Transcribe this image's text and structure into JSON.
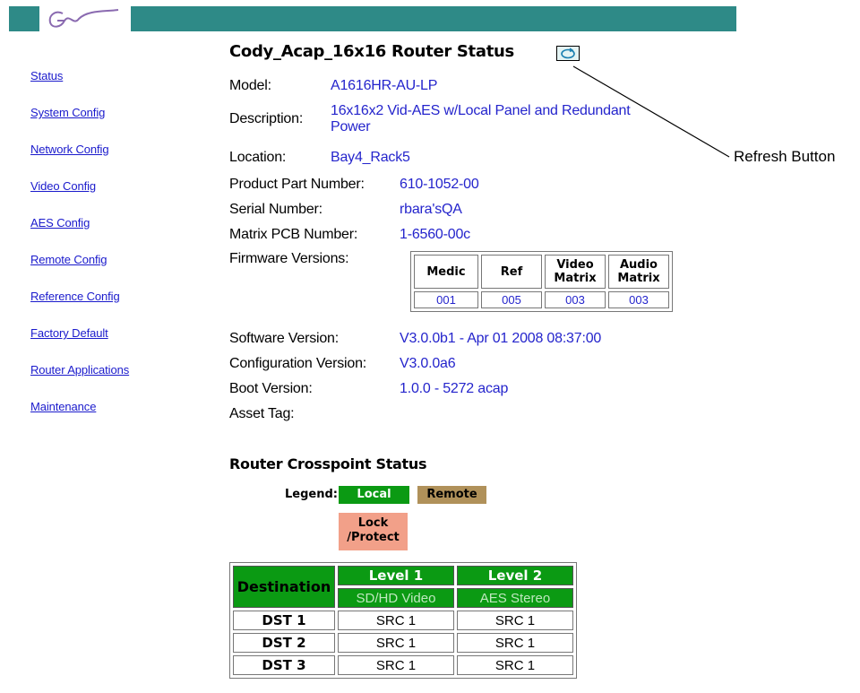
{
  "header": {
    "brand_color": "#2e8a87",
    "logo_icon": "grass-valley-logo"
  },
  "nav": {
    "items": [
      {
        "label": "Status"
      },
      {
        "label": "System Config"
      },
      {
        "label": "Network Config"
      },
      {
        "label": "Video Config"
      },
      {
        "label": "AES Config"
      },
      {
        "label": "Remote Config"
      },
      {
        "label": "Reference Config"
      },
      {
        "label": "Factory Default"
      },
      {
        "label": "Router Applications"
      },
      {
        "label": "Maintenance"
      }
    ]
  },
  "page": {
    "title": "Cody_Acap_16x16 Router Status",
    "refresh_icon": "refresh-icon",
    "annotation": "Refresh Button"
  },
  "info": {
    "model_label": "Model:",
    "model_value": "A1616HR-AU-LP",
    "description_label": "Description:",
    "description_value_line1": "16x16x2 Vid-AES w/Local Panel and Redundant",
    "description_value_line2": "Power",
    "location_label": "Location:",
    "location_value": "Bay4_Rack5",
    "part_label": "Product Part Number:",
    "part_value": "610-1052-00",
    "serial_label": "Serial Number:",
    "serial_value": "rbara'sQA",
    "pcb_label": "Matrix PCB Number:",
    "pcb_value": "1-6560-00c",
    "firmware_label": "Firmware Versions:",
    "software_label": "Software Version:",
    "software_value": "V3.0.0b1 - Apr 01 2008 08:37:00",
    "config_label": "Configuration Version:",
    "config_value": "V3.0.0a6",
    "boot_label": "Boot Version:",
    "boot_value": "1.0.0 - 5272 acap",
    "asset_label": "Asset Tag:"
  },
  "firmware": {
    "headers": [
      "Medic",
      "Ref",
      "Video\nMatrix",
      "Audio\nMatrix"
    ],
    "header_lines": [
      [
        "Medic"
      ],
      [
        "Ref"
      ],
      [
        "Video",
        "Matrix"
      ],
      [
        "Audio",
        "Matrix"
      ]
    ],
    "values": [
      "001",
      "005",
      "003",
      "003"
    ]
  },
  "crosspoint": {
    "title": "Router Crosspoint Status",
    "legend_label": "Legend:",
    "legend_local": "Local",
    "legend_remote": "Remote",
    "legend_lock_line1": "Lock",
    "legend_lock_line2": "/Protect",
    "colors": {
      "local": "#0b9a13",
      "remote": "#b0915a",
      "lock": "#f2a089"
    },
    "destination_header": "Destination",
    "levels": [
      {
        "label": "Level 1",
        "type": "SD/HD Video"
      },
      {
        "label": "Level 2",
        "type": "AES Stereo"
      }
    ],
    "rows": [
      {
        "dst": "DST 1",
        "l1": "SRC 1",
        "l2": "SRC 1"
      },
      {
        "dst": "DST 2",
        "l1": "SRC 1",
        "l2": "SRC 1"
      },
      {
        "dst": "DST 3",
        "l1": "SRC 1",
        "l2": "SRC 1"
      }
    ]
  }
}
